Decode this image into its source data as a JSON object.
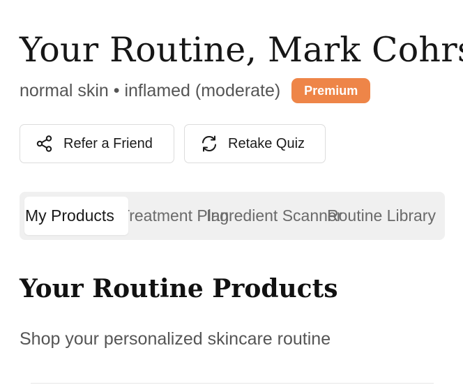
{
  "header": {
    "title": "Your Routine, Mark Cohrs",
    "skin_meta": "normal skin • inflamed (moderate)",
    "badge": "Premium"
  },
  "actions": {
    "refer_label": "Refer a Friend",
    "retake_label": "Retake Quiz"
  },
  "tabs": [
    {
      "label": "My Products",
      "active": true
    },
    {
      "label": "Treatment Plan",
      "active": false
    },
    {
      "label": "Ingredient Scanner",
      "active": false
    },
    {
      "label": "Routine Library",
      "active": false
    }
  ],
  "section": {
    "title": "Your Routine Products",
    "subtitle": "Shop your personalized skincare routine"
  },
  "colors": {
    "badge_bg": "#ee8548",
    "tabs_bg": "#f0f0f0",
    "text_muted": "#555555"
  },
  "icons": {
    "refer": "share-icon",
    "retake": "refresh-icon"
  }
}
